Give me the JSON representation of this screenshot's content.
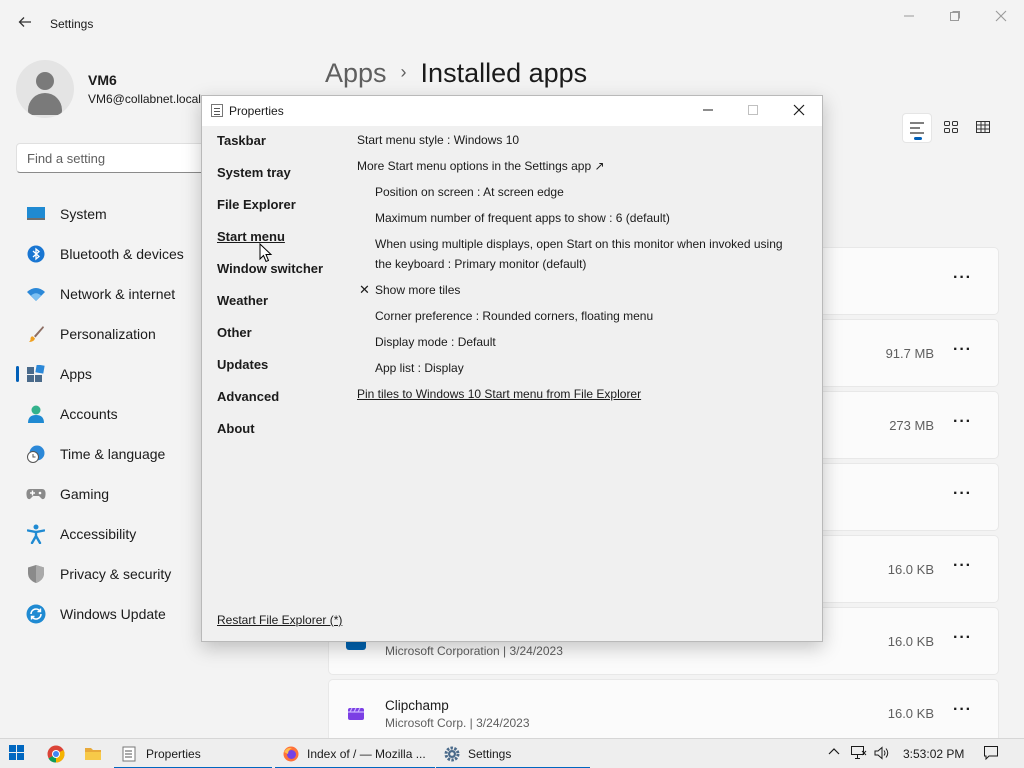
{
  "settings": {
    "title": "Settings",
    "back_icon": "back-arrow-icon",
    "window_controls": [
      "minimize",
      "maximize",
      "close"
    ],
    "profile": {
      "name": "VM6",
      "email": "VM6@collabnet.local"
    },
    "search": {
      "placeholder": "Find a setting"
    },
    "nav": [
      {
        "label": "System",
        "icon": "system-icon"
      },
      {
        "label": "Bluetooth & devices",
        "icon": "bluetooth-icon"
      },
      {
        "label": "Network & internet",
        "icon": "network-icon"
      },
      {
        "label": "Personalization",
        "icon": "brush-icon"
      },
      {
        "label": "Apps",
        "icon": "apps-icon",
        "active": true
      },
      {
        "label": "Accounts",
        "icon": "accounts-icon"
      },
      {
        "label": "Time & language",
        "icon": "time-language-icon"
      },
      {
        "label": "Gaming",
        "icon": "gamepad-icon"
      },
      {
        "label": "Accessibility",
        "icon": "accessibility-icon"
      },
      {
        "label": "Privacy & security",
        "icon": "shield-icon"
      },
      {
        "label": "Windows Update",
        "icon": "update-icon"
      }
    ],
    "breadcrumb": {
      "parent": "Apps",
      "separator": "›",
      "current": "Installed apps"
    },
    "view_modes": [
      "list-view-icon",
      "tile-view-icon",
      "grid-view-icon"
    ],
    "apps": [
      {
        "name": "",
        "meta": "",
        "size": ""
      },
      {
        "name": "",
        "meta": "",
        "size": "91.7 MB"
      },
      {
        "name": "",
        "meta": "",
        "size": "273 MB"
      },
      {
        "name": "",
        "meta": "",
        "size": ""
      },
      {
        "name": "",
        "meta": "",
        "size": "16.0 KB"
      },
      {
        "name": "",
        "meta": "Microsoft Corporation  |  3/24/2023",
        "size": "16.0 KB"
      },
      {
        "name": "Clipchamp",
        "meta": "Microsoft Corp.  |  3/24/2023",
        "size": "16.0 KB"
      }
    ],
    "more_label": "···"
  },
  "properties": {
    "title": "Properties",
    "nav": [
      "Taskbar",
      "System tray",
      "File Explorer",
      "Start menu",
      "Window switcher",
      "Weather",
      "Other",
      "Updates",
      "Advanced",
      "About"
    ],
    "active_nav": "Start menu",
    "options": [
      {
        "text": "Start menu style : Windows 10",
        "indent": false
      },
      {
        "text": "More Start menu options in the Settings app ↗",
        "indent": false
      },
      {
        "text": "Position on screen : At screen edge",
        "indent": true
      },
      {
        "text": "Maximum number of frequent apps to show : 6 (default)",
        "indent": true
      },
      {
        "text": "When using multiple displays, open Start on this monitor when invoked using the keyboard : Primary monitor (default)",
        "indent": true
      },
      {
        "text": "Show more tiles",
        "indent": true,
        "checked": true
      },
      {
        "text": "Corner preference : Rounded corners, floating menu",
        "indent": true
      },
      {
        "text": "Display mode : Default",
        "indent": true
      },
      {
        "text": "App list : Display",
        "indent": true
      }
    ],
    "pin_link": "Pin tiles to Windows 10 Start menu from File Explorer",
    "restart_link": "Restart File Explorer (*)"
  },
  "taskbar": {
    "tasks": [
      {
        "label": "Properties",
        "icon": "properties-icon"
      },
      {
        "label": "Index of / — Mozilla ...",
        "icon": "firefox-icon"
      },
      {
        "label": "Settings",
        "icon": "settings-gear-icon"
      }
    ],
    "clock": "3:53:02 PM"
  },
  "colors": {
    "accent": "#005fb8",
    "taskbar_accent": "#0067c0"
  }
}
